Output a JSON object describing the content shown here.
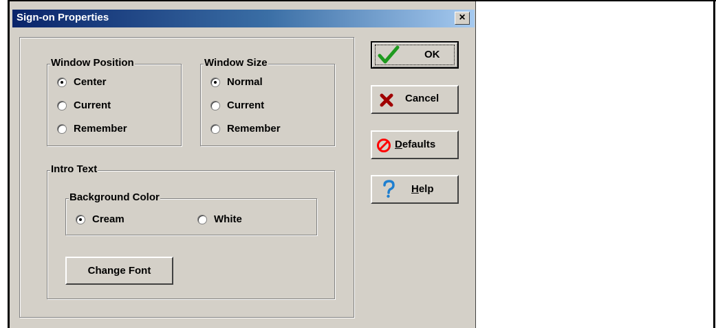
{
  "window": {
    "title": "Sign-on Properties",
    "close_label": "×"
  },
  "window_position": {
    "label": "Window Position",
    "options": [
      {
        "label": "Center",
        "checked": true
      },
      {
        "label": "Current",
        "checked": false
      },
      {
        "label": "Remember",
        "checked": false
      }
    ]
  },
  "window_size": {
    "label": "Window Size",
    "options": [
      {
        "label": "Normal",
        "checked": true
      },
      {
        "label": "Current",
        "checked": false
      },
      {
        "label": "Remember",
        "checked": false
      }
    ]
  },
  "intro_text": {
    "label": "Intro Text",
    "background_color": {
      "label": "Background Color",
      "options": [
        {
          "label": "Cream",
          "checked": true
        },
        {
          "label": "White",
          "checked": false
        }
      ]
    },
    "change_font_label": "Change Font"
  },
  "buttons": {
    "ok": "OK",
    "cancel": "Cancel",
    "defaults_accel": "D",
    "defaults_rest": "efaults",
    "help_accel": "H",
    "help_rest": "elp"
  },
  "icons": {
    "ok": "check-icon",
    "cancel": "x-icon",
    "defaults": "no-sign-icon",
    "help": "question-icon"
  },
  "colors": {
    "title_start": "#0a246a",
    "title_end": "#a6caf0",
    "dialog_bg": "#d4d0c8",
    "check_green": "#1f9a1f",
    "cancel_red": "#a00000",
    "defaults_red": "#ff0000",
    "help_blue": "#1e7fd0"
  }
}
